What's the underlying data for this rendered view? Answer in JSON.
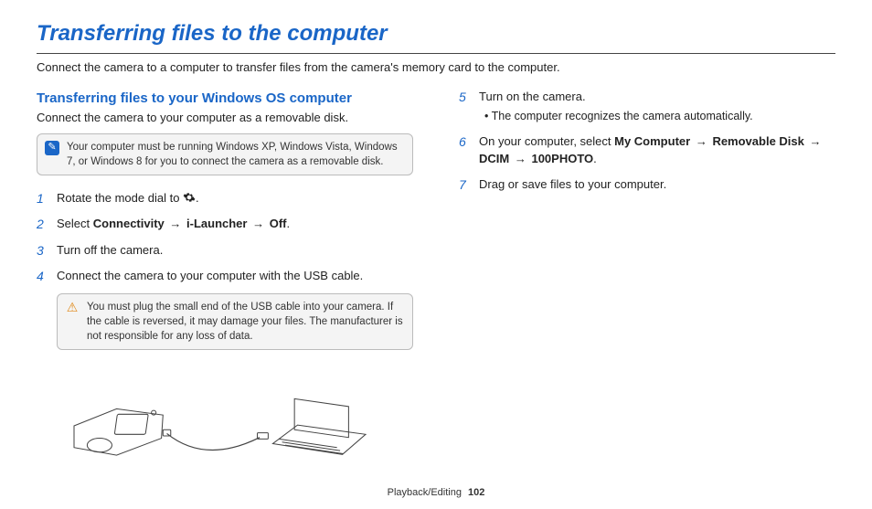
{
  "title": "Transferring files to the computer",
  "intro": "Connect the camera to a computer to transfer files from the camera's memory card to the computer.",
  "section": {
    "title": "Transferring files to your Windows OS computer",
    "intro": "Connect the camera to your computer as a removable disk.",
    "note": "Your computer must be running Windows XP, Windows Vista, Windows 7, or Windows 8 for you to connect the camera as a removable disk."
  },
  "steps_left": {
    "s1_pre": "Rotate the mode dial to ",
    "s1_post": ".",
    "s2_pre": "Select ",
    "s2_b1": "Connectivity",
    "s2_b2": "i-Launcher",
    "s2_b3": "Off",
    "s2_post": ".",
    "s3": "Turn off the camera.",
    "s4": "Connect the camera to your computer with the USB cable."
  },
  "warn": "You must plug the small end of the USB cable into your camera. If the cable is reversed, it may damage your files. The manufacturer is not responsible for any loss of data.",
  "steps_right": {
    "s5": "Turn on the camera.",
    "s5_sub": "The computer recognizes the camera automatically.",
    "s6_pre": "On your computer, select ",
    "s6_b1": "My Computer",
    "s6_b2": "Removable Disk",
    "s6_b3": "DCIM",
    "s6_b4": "100PHOTO",
    "s6_post": ".",
    "s7": "Drag or save files to your computer."
  },
  "arrow": "→",
  "footer": {
    "section": "Playback/Editing",
    "page": "102"
  },
  "nums": {
    "n1": "1",
    "n2": "2",
    "n3": "3",
    "n4": "4",
    "n5": "5",
    "n6": "6",
    "n7": "7"
  },
  "icons": {
    "note": "✎",
    "warn": "⚠"
  }
}
